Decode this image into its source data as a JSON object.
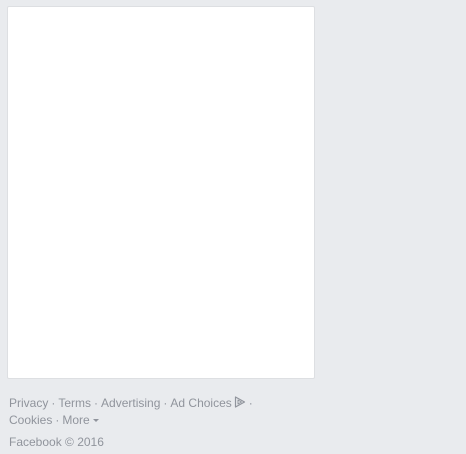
{
  "footer": {
    "links_row1": {
      "privacy": "Privacy",
      "terms": "Terms",
      "advertising": "Advertising",
      "ad_choices": "Ad Choices"
    },
    "links_row2": {
      "cookies": "Cookies",
      "more": "More"
    },
    "separator": "·",
    "copyright": "Facebook © 2016"
  },
  "colors": {
    "page_background": "#e9ebee",
    "card_background": "#ffffff",
    "footer_text": "#90949c"
  },
  "icons": {
    "ad_choices": "adchoices-icon",
    "more": "chevron-down-icon"
  }
}
